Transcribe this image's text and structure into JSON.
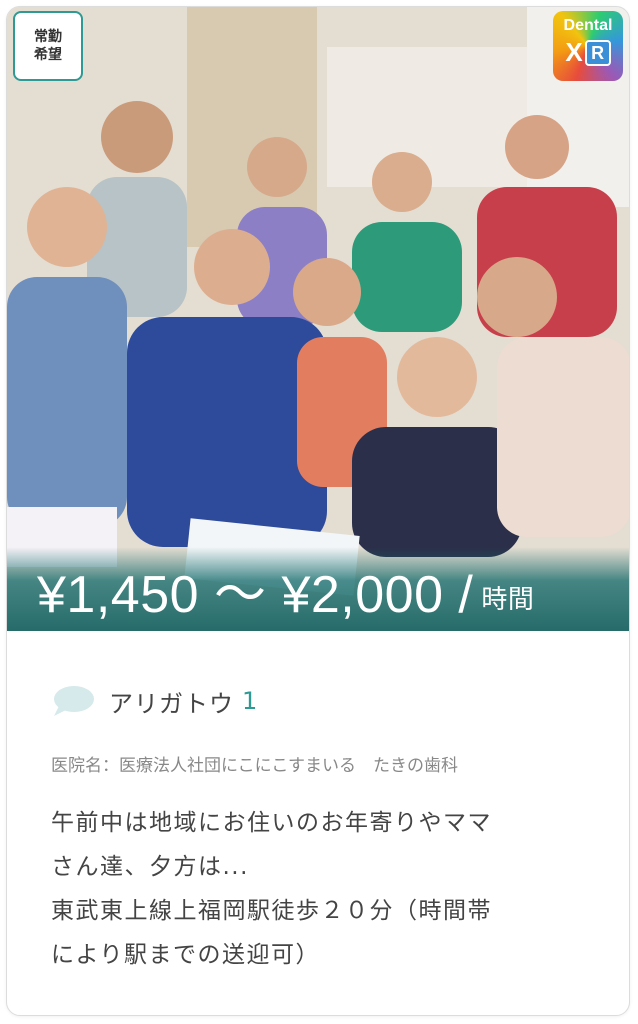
{
  "badge": {
    "line1": "常勤",
    "line2": "希望"
  },
  "logo": {
    "top": "Dental",
    "x": "X",
    "r": "R"
  },
  "price": {
    "range": "¥1,450 ～ ¥2,000 /",
    "unit": "時間"
  },
  "thanks": {
    "label": "アリガトウ",
    "count": "1",
    "icon": "speech-bubble-icon"
  },
  "clinic": {
    "text": "医院名：医療法人社団にこにこすまいる　たきの歯科"
  },
  "description": {
    "line1": "午前中は地域にお住いのお年寄りやママ",
    "line2": "さん達、夕方は...",
    "line3": "東武東上線上福岡駅徒歩２０分（時間帯",
    "line4": "により駅までの送迎可）"
  },
  "colors": {
    "accent": "#2e9a93",
    "price_overlay": "#0c5c5c",
    "text_primary": "#444444",
    "text_muted": "#888888"
  }
}
